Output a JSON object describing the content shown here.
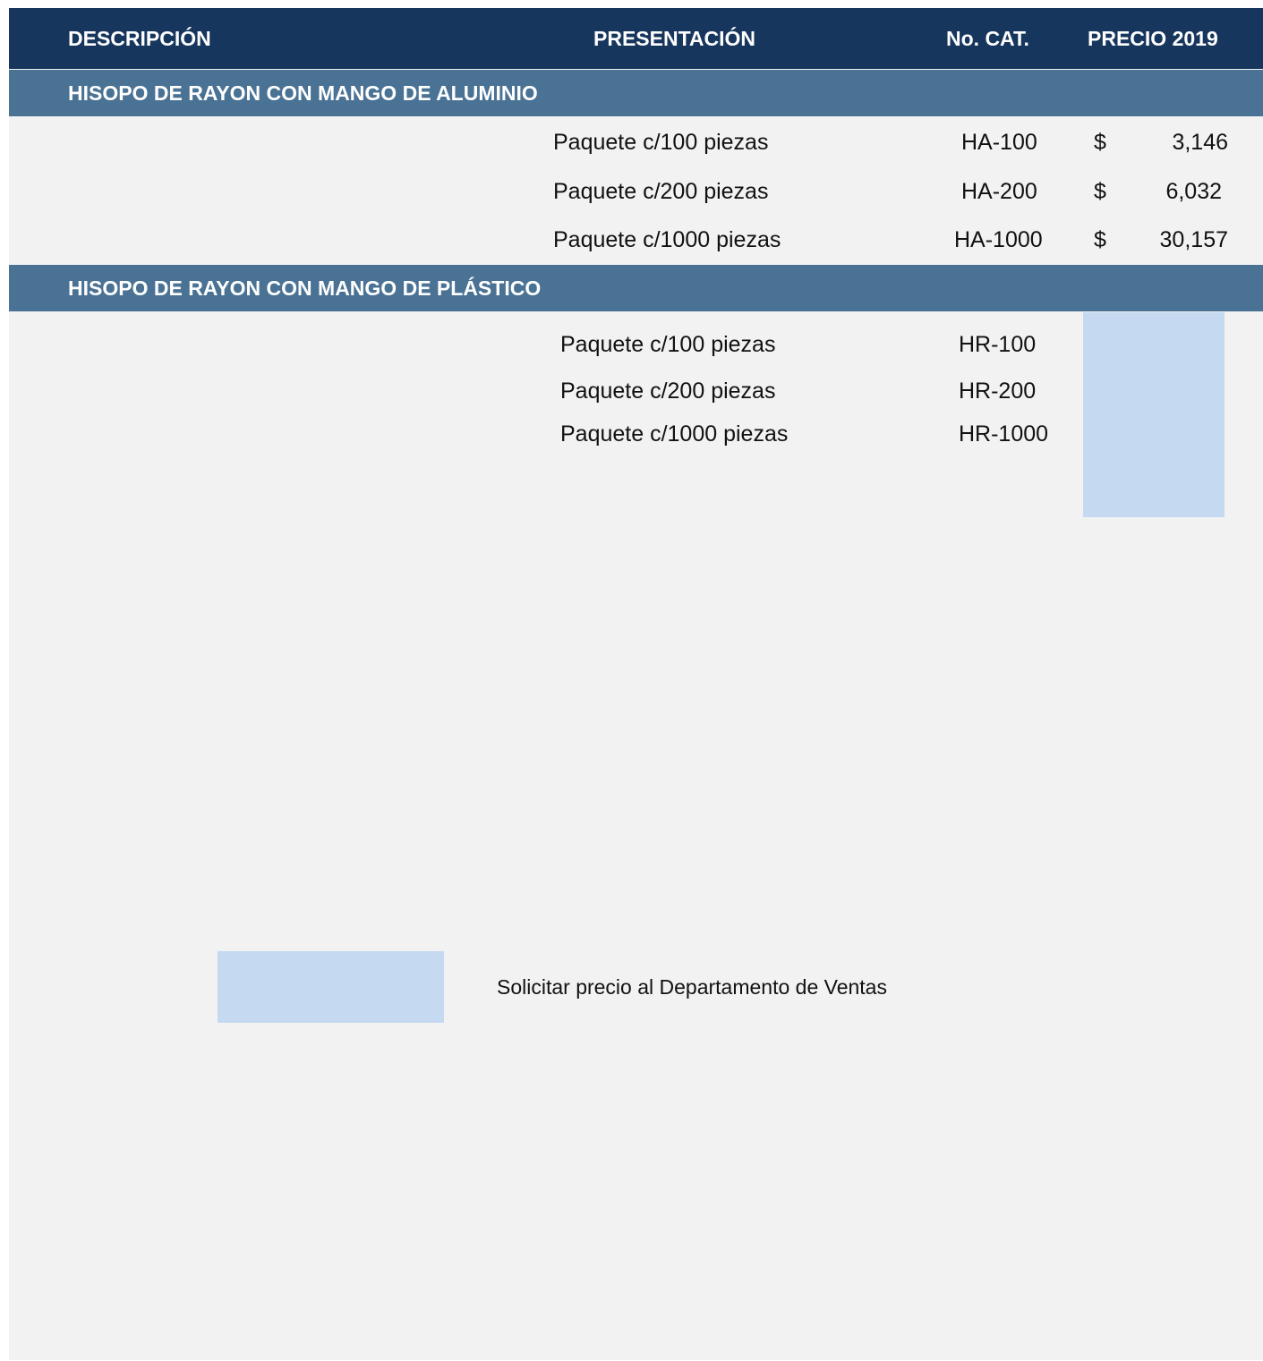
{
  "header": {
    "descripcion": "DESCRIPCIÓN",
    "presentacion": "PRESENTACIÓN",
    "no_cat": "No. CAT.",
    "precio": "PRECIO 2019"
  },
  "sections": [
    {
      "title": "HISOPO DE RAYON CON MANGO DE ALUMINIO",
      "rows": [
        {
          "presentacion": "Paquete c/100 piezas",
          "no_cat": "HA-100",
          "currency": "$",
          "precio": "3,146"
        },
        {
          "presentacion": "Paquete c/200 piezas",
          "no_cat": "HA-200",
          "currency": "$",
          "precio": "6,032"
        },
        {
          "presentacion": "Paquete c/1000 piezas",
          "no_cat": "HA-1000",
          "currency": "$",
          "precio": "30,157"
        }
      ]
    },
    {
      "title": "HISOPO DE RAYON CON MANGO DE PLÁSTICO",
      "rows": [
        {
          "presentacion": "Paquete c/100 piezas",
          "no_cat": "HR-100"
        },
        {
          "presentacion": "Paquete c/200 piezas",
          "no_cat": "HR-200"
        },
        {
          "presentacion": "Paquete c/1000 piezas",
          "no_cat": "HR-1000"
        }
      ]
    }
  ],
  "legend": {
    "text": "Solicitar precio al Departamento de Ventas",
    "swatch_color": "#c5d9f1"
  },
  "colors": {
    "header_bg": "#17365d",
    "section_bg": "#4a7294",
    "sheet_bg": "#f2f2f2",
    "placeholder": "#c5d9f1"
  }
}
